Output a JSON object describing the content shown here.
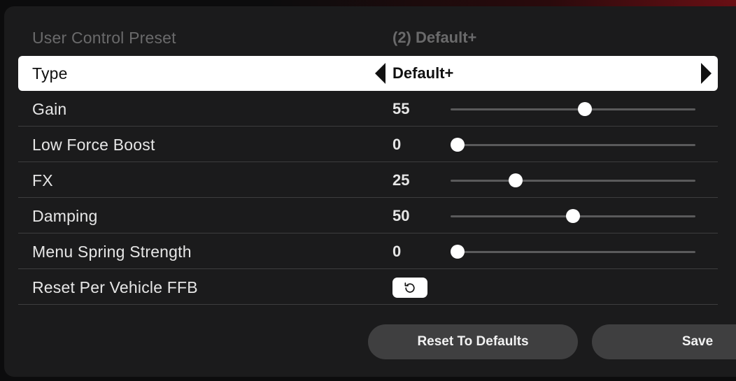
{
  "header": {
    "label": "User Control Preset",
    "value": "(2) Default+"
  },
  "type_row": {
    "label": "Type",
    "value": "Default+"
  },
  "rows": [
    {
      "label": "Gain",
      "value": "55",
      "fraction": 0.55
    },
    {
      "label": "Low Force Boost",
      "value": "0",
      "fraction": 0.0
    },
    {
      "label": "FX",
      "value": "25",
      "fraction": 0.25
    },
    {
      "label": "Damping",
      "value": "50",
      "fraction": 0.5
    },
    {
      "label": "Menu Spring Strength",
      "value": "0",
      "fraction": 0.0
    }
  ],
  "reset_row": {
    "label": "Reset Per Vehicle FFB",
    "icon": "reset-icon"
  },
  "buttons": {
    "reset_defaults": "Reset To Defaults",
    "save": "Save"
  }
}
